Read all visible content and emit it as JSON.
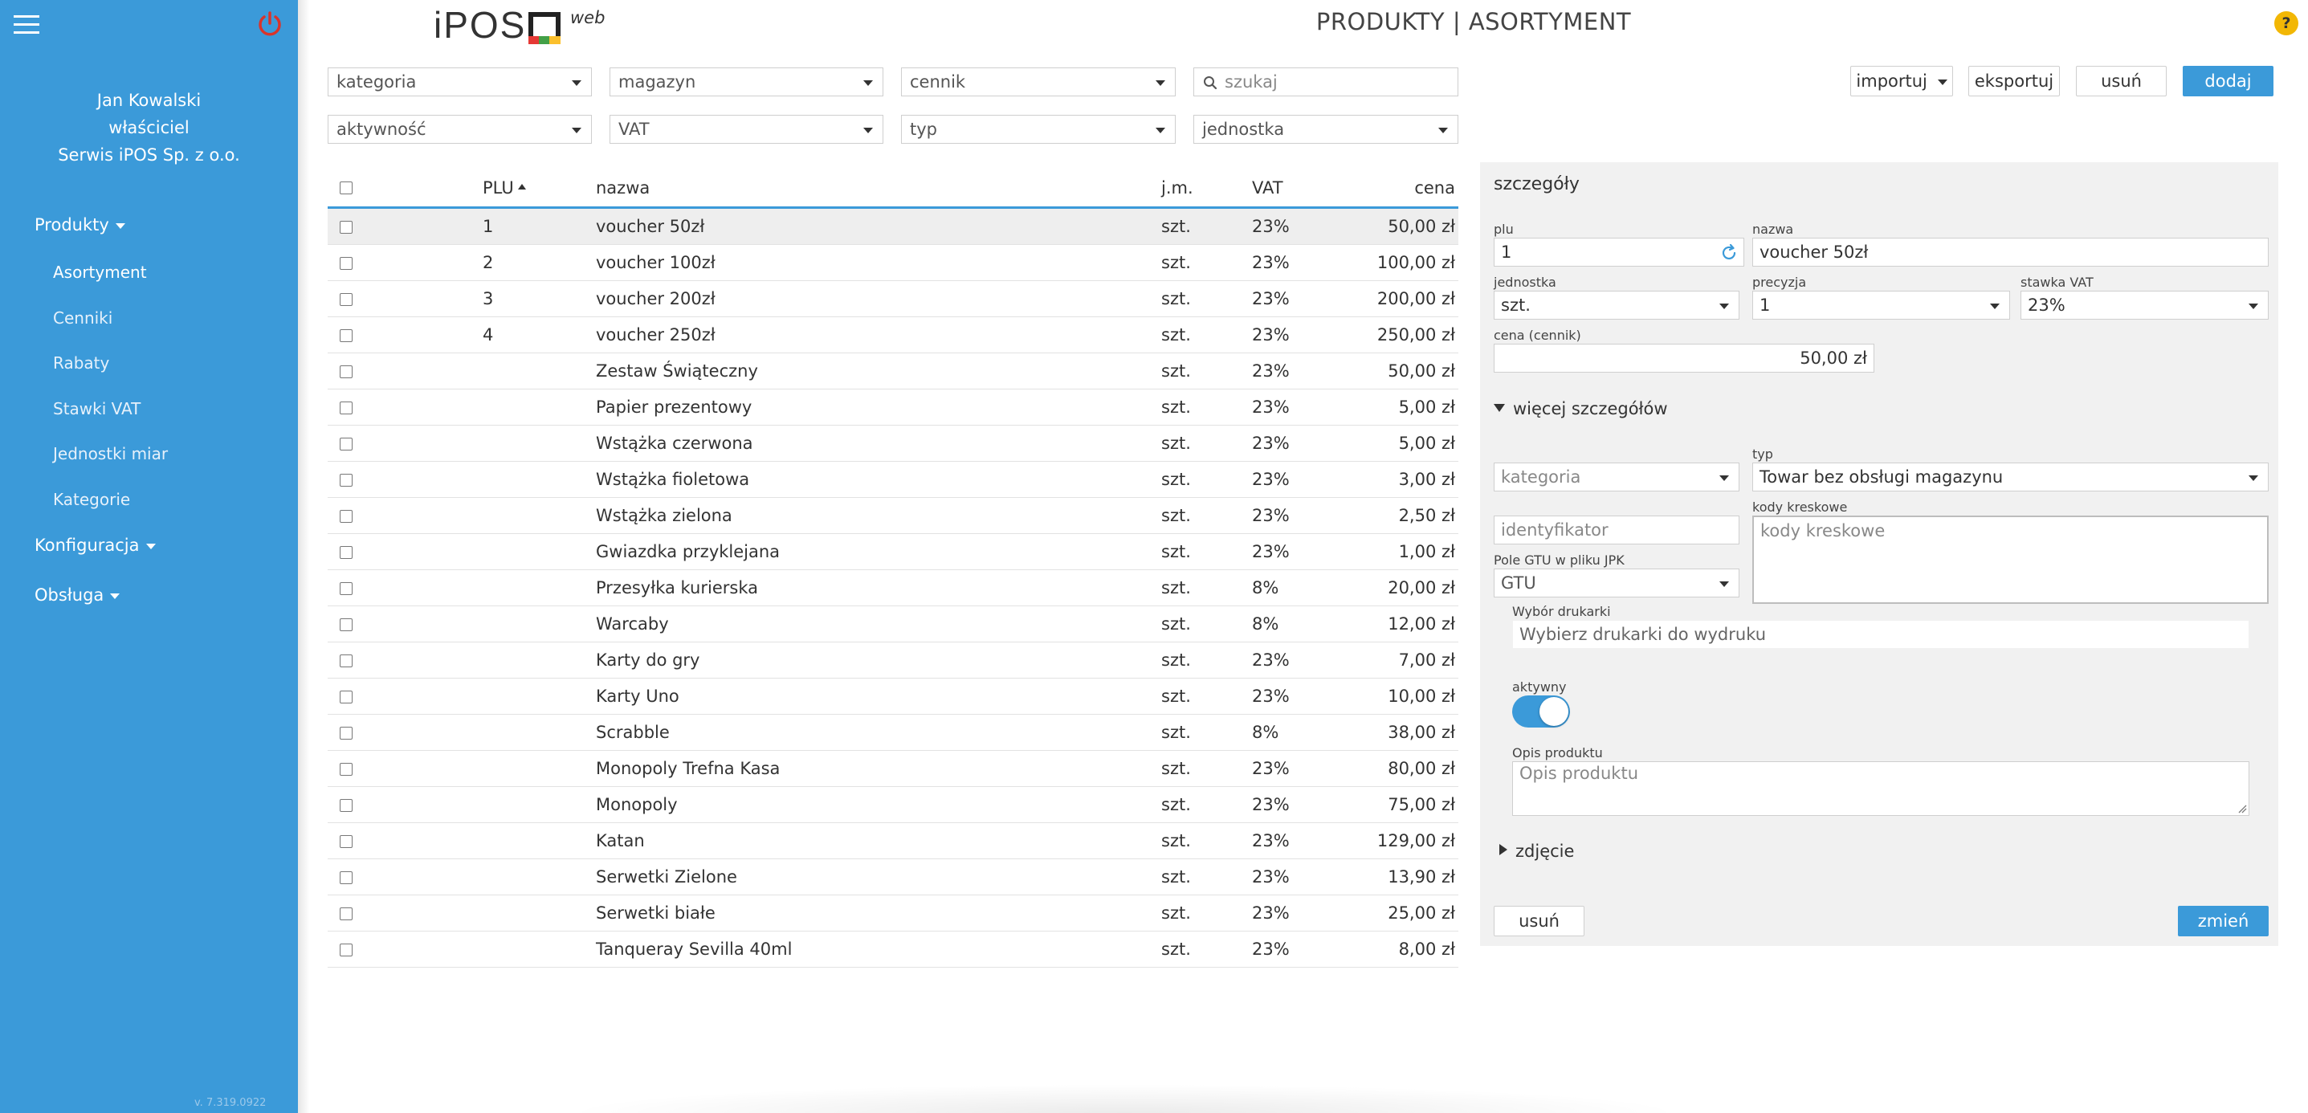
{
  "sidebar": {
    "user_name": "Jan Kowalski",
    "user_role": "właściciel",
    "company": "Serwis iPOS Sp. z o.o.",
    "nav": {
      "produkty": "Produkty",
      "asortyment": "Asortyment",
      "cenniki": "Cenniki",
      "rabaty": "Rabaty",
      "stawki_vat": "Stawki VAT",
      "jednostki": "Jednostki miar",
      "kategorie": "Kategorie",
      "konfiguracja": "Konfiguracja",
      "obsluga": "Obsługa"
    },
    "version": "v. 7.319.0922"
  },
  "header": {
    "logo_text": "iPOS",
    "logo_web": "web",
    "title": "PRODUKTY | ASORTYMENT",
    "help": "?"
  },
  "filters": {
    "kategoria": "kategoria",
    "magazyn": "magazyn",
    "cennik": "cennik",
    "search_placeholder": "szukaj",
    "aktywnosc": "aktywność",
    "vat": "VAT",
    "typ": "typ",
    "jednostka": "jednostka"
  },
  "toolbar": {
    "importuj": "importuj",
    "eksportuj": "eksportuj",
    "usun": "usuń",
    "dodaj": "dodaj"
  },
  "table": {
    "headers": {
      "plu": "PLU",
      "nazwa": "nazwa",
      "jm": "j.m.",
      "vat": "VAT",
      "cena": "cena"
    },
    "rows": [
      {
        "plu": "1",
        "nazwa": "voucher 50zł",
        "jm": "szt.",
        "vat": "23%",
        "cena": "50,00 zł"
      },
      {
        "plu": "2",
        "nazwa": "voucher 100zł",
        "jm": "szt.",
        "vat": "23%",
        "cena": "100,00 zł"
      },
      {
        "plu": "3",
        "nazwa": "voucher 200zł",
        "jm": "szt.",
        "vat": "23%",
        "cena": "200,00 zł"
      },
      {
        "plu": "4",
        "nazwa": "voucher 250zł",
        "jm": "szt.",
        "vat": "23%",
        "cena": "250,00 zł"
      },
      {
        "plu": "",
        "nazwa": "Zestaw Świąteczny",
        "jm": "szt.",
        "vat": "23%",
        "cena": "50,00 zł"
      },
      {
        "plu": "",
        "nazwa": "Papier prezentowy",
        "jm": "szt.",
        "vat": "23%",
        "cena": "5,00 zł"
      },
      {
        "plu": "",
        "nazwa": "Wstążka czerwona",
        "jm": "szt.",
        "vat": "23%",
        "cena": "5,00 zł"
      },
      {
        "plu": "",
        "nazwa": "Wstążka fioletowa",
        "jm": "szt.",
        "vat": "23%",
        "cena": "3,00 zł"
      },
      {
        "plu": "",
        "nazwa": "Wstążka zielona",
        "jm": "szt.",
        "vat": "23%",
        "cena": "2,50 zł"
      },
      {
        "plu": "",
        "nazwa": "Gwiazdka przyklejana",
        "jm": "szt.",
        "vat": "23%",
        "cena": "1,00 zł"
      },
      {
        "plu": "",
        "nazwa": "Przesyłka kurierska",
        "jm": "szt.",
        "vat": "8%",
        "cena": "20,00 zł"
      },
      {
        "plu": "",
        "nazwa": "Warcaby",
        "jm": "szt.",
        "vat": "8%",
        "cena": "12,00 zł"
      },
      {
        "plu": "",
        "nazwa": "Karty do gry",
        "jm": "szt.",
        "vat": "23%",
        "cena": "7,00 zł"
      },
      {
        "plu": "",
        "nazwa": "Karty Uno",
        "jm": "szt.",
        "vat": "23%",
        "cena": "10,00 zł"
      },
      {
        "plu": "",
        "nazwa": "Scrabble",
        "jm": "szt.",
        "vat": "8%",
        "cena": "38,00 zł"
      },
      {
        "plu": "",
        "nazwa": "Monopoly Trefna Kasa",
        "jm": "szt.",
        "vat": "23%",
        "cena": "80,00 zł"
      },
      {
        "plu": "",
        "nazwa": "Monopoly",
        "jm": "szt.",
        "vat": "23%",
        "cena": "75,00 zł"
      },
      {
        "plu": "",
        "nazwa": "Katan",
        "jm": "szt.",
        "vat": "23%",
        "cena": "129,00 zł"
      },
      {
        "plu": "",
        "nazwa": "Serwetki Zielone",
        "jm": "szt.",
        "vat": "23%",
        "cena": "13,90 zł"
      },
      {
        "plu": "",
        "nazwa": "Serwetki białe",
        "jm": "szt.",
        "vat": "23%",
        "cena": "25,00 zł"
      },
      {
        "plu": "",
        "nazwa": "Tanqueray Sevilla 40ml",
        "jm": "szt.",
        "vat": "23%",
        "cena": "8,00 zł"
      }
    ]
  },
  "details": {
    "title": "szczegóły",
    "plu_label": "plu",
    "plu_value": "1",
    "nazwa_label": "nazwa",
    "nazwa_value": "voucher 50zł",
    "jednostka_label": "jednostka",
    "jednostka_value": "szt.",
    "precyzja_label": "precyzja",
    "precyzja_value": "1",
    "stawka_label": "stawka VAT",
    "stawka_value": "23%",
    "cena_label": "cena (cennik)",
    "cena_value": "50,00 zł",
    "more_label": "więcej szczegółów",
    "typ_label": "typ",
    "kategoria_placeholder": "kategoria",
    "typ_value": "Towar bez obsługi magazynu",
    "kody_label": "kody kreskowe",
    "identyfikator_placeholder": "identyfikator",
    "kody_placeholder": "kody kreskowe",
    "gtu_label": "Pole GTU w pliku JPK",
    "gtu_value": "GTU",
    "drukarki_label": "Wybór drukarki",
    "drukarki_placeholder": "Wybierz drukarki do wydruku",
    "aktywny_label": "aktywny",
    "aktywny_on": true,
    "opis_label": "Opis produktu",
    "opis_placeholder": "Opis produktu",
    "zdjecie_label": "zdjęcie",
    "usun_button": "usuń",
    "zmien_button": "zmień"
  },
  "colors": {
    "accent": "#3b9ad9",
    "help": "#f2b705",
    "power": "#d9342b"
  }
}
